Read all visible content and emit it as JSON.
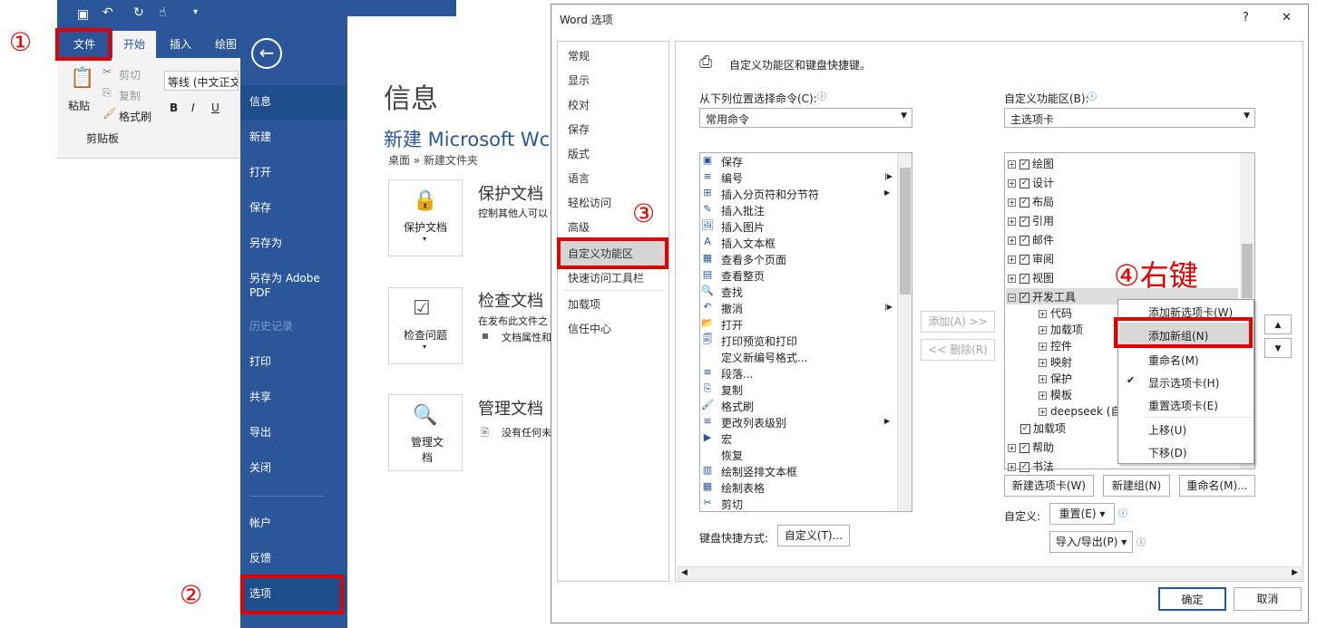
{
  "annotations": {
    "n1": "①",
    "n2": "②",
    "n3": "③",
    "n4": "④右键"
  },
  "ribbon": {
    "tabs": [
      "文件",
      "开始",
      "插入",
      "绘图"
    ],
    "paste": "粘贴",
    "cut": "剪切",
    "copy": "复制",
    "format_painter": "格式刷",
    "font": "等线 (中文正文)",
    "clipboard": "剪贴板",
    "bold": "B",
    "italic": "I",
    "underline": "U"
  },
  "backstage": {
    "nav": [
      "信息",
      "新建",
      "打开",
      "保存",
      "另存为",
      "另存为 Adobe PDF",
      "历史记录",
      "打印",
      "共享",
      "导出",
      "关闭",
      "帐户",
      "反馈",
      "选项"
    ],
    "title": "信息",
    "doc_title": "新建 Microsoft Wc",
    "path": "桌面 » 新建文件夹",
    "tiles": [
      {
        "label": "保护文档",
        "heading": "保护文档",
        "desc": "控制其他人可以"
      },
      {
        "label": "检查问题",
        "heading": "检查文档",
        "desc": "在发布此文件之",
        "bullet": "文档属性和"
      },
      {
        "label": "管理文档",
        "heading": "管理文档",
        "desc": "没有任何未"
      }
    ]
  },
  "dialog": {
    "title": "Word 选项",
    "help": "?",
    "close": "✕",
    "categories": [
      "常规",
      "显示",
      "校对",
      "保存",
      "版式",
      "语言",
      "轻松访问",
      "高级",
      "自定义功能区",
      "快速访问工具栏",
      "加载项",
      "信任中心"
    ],
    "header": "自定义功能区和键盘快捷键。",
    "choose_label": "从下列位置选择命令(C):",
    "choose_value": "常用命令",
    "customize_label": "自定义功能区(B):",
    "customize_value": "主选项卡",
    "commands": [
      "保存",
      "编号",
      "插入分页符和分节符",
      "插入批注",
      "插入图片",
      "插入文本框",
      "查看多个页面",
      "查看整页",
      "查找",
      "撤消",
      "打开",
      "打印预览和打印",
      "定义新编号格式...",
      "段落...",
      "复制",
      "格式刷",
      "更改列表级别",
      "宏",
      "恢复",
      "绘制竖排文本框",
      "绘制表格",
      "剪切"
    ],
    "add_btn": "添加(A) >>",
    "remove_btn": "<< 删除(R)",
    "tree_tabs": [
      "绘图",
      "设计",
      "布局",
      "引用",
      "邮件",
      "审阅",
      "视图",
      "开发工具"
    ],
    "dev_groups": [
      "代码",
      "加载项",
      "控件",
      "映射",
      "保护",
      "模板",
      "deepseek (自"
    ],
    "tree_tabs_after": [
      "加载项",
      "帮助",
      "书法"
    ],
    "context_menu": [
      "添加新选项卡(W)",
      "添加新组(N)",
      "重命名(M)",
      "显示选项卡(H)",
      "重置选项卡(E)",
      "上移(U)",
      "下移(D)"
    ],
    "new_tab_btn": "新建选项卡(W)",
    "new_group_btn": "新建组(N)",
    "rename_btn": "重命名(M)...",
    "customizations_label": "自定义:",
    "reset_btn": "重置(E) ▾",
    "import_export_btn": "导入/导出(P) ▾",
    "keyboard_label": "键盘快捷方式:",
    "keyboard_btn": "自定义(T)...",
    "ok": "确定",
    "cancel": "取消"
  }
}
